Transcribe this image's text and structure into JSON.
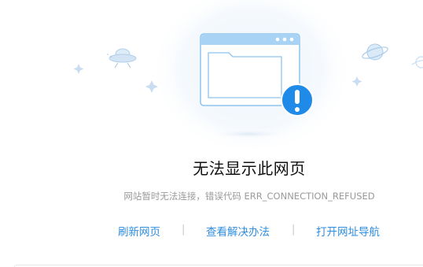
{
  "error": {
    "title": "无法显示此网页",
    "message": "网站暂时无法连接，错误代码 ERR_CONNECTION_REFUSED"
  },
  "actions": {
    "refresh_label": "刷新网页",
    "solution_label": "查看解决办法",
    "nav_label": "打开网址导航",
    "separator": "|"
  },
  "colors": {
    "accent": "#2f8ee0",
    "alert": "#1f8ae8",
    "window_border": "#8ec4ef",
    "window_fill": "#ffffff",
    "title_text": "#111111",
    "message_text": "#9a9a9a",
    "glow": "#eef5fc"
  },
  "icons": {
    "browser_window": "browser-window-icon",
    "alert_badge": "exclamation-icon",
    "ufo": "ufo-icon",
    "planet": "planet-icon",
    "sparkle": "sparkle-icon"
  }
}
